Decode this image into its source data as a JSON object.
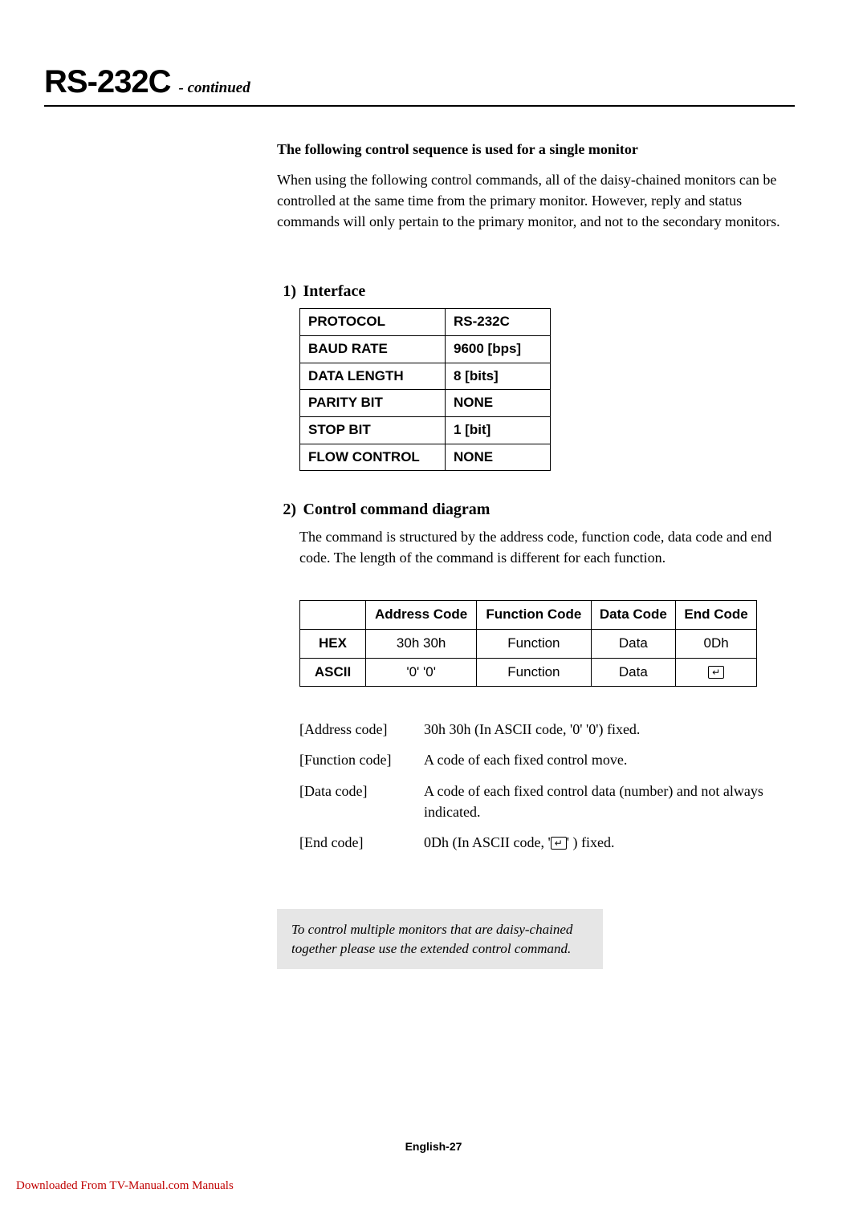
{
  "header": {
    "title": "RS-232C",
    "sub": "- continued"
  },
  "intro": {
    "heading": "The following control sequence is used for a single monitor",
    "body": "When using the following control commands, all of the daisy-chained monitors can be controlled at the same time from the primary monitor. However, reply and status commands will only pertain to the primary monitor, and not to the secondary monitors."
  },
  "section1": {
    "num": "1)",
    "title": "Interface",
    "rows": [
      {
        "k": "PROTOCOL",
        "v": "RS-232C"
      },
      {
        "k": "BAUD RATE",
        "v": "9600 [bps]"
      },
      {
        "k": "DATA LENGTH",
        "v": "8 [bits]"
      },
      {
        "k": "PARITY BIT",
        "v": "NONE"
      },
      {
        "k": "STOP BIT",
        "v": "1 [bit]"
      },
      {
        "k": "FLOW CONTROL",
        "v": "NONE"
      }
    ]
  },
  "section2": {
    "num": "2)",
    "title": "Control command diagram",
    "body": "The command is structured by the address code, function code, data code and end code. The length of the command is different for each function.",
    "table": {
      "headers": [
        "",
        "Address Code",
        "Function Code",
        "Data Code",
        "End Code"
      ],
      "rows": [
        {
          "label": "HEX",
          "cells": [
            "30h 30h",
            "Function",
            "Data",
            "0Dh"
          ]
        },
        {
          "label": "ASCII",
          "cells": [
            "'0' '0'",
            "Function",
            "Data",
            "↵"
          ]
        }
      ]
    },
    "defs": [
      {
        "label": "[Address code]",
        "value": "30h 30h (In ASCII code, '0' '0') fixed."
      },
      {
        "label": "[Function code]",
        "value": "A code of each fixed control move."
      },
      {
        "label": "[Data code]",
        "value": "A code of each fixed control data (number) and not always indicated."
      },
      {
        "label": "[End code]",
        "value": "0Dh (In ASCII code, ' ↵ ' ) fixed."
      }
    ]
  },
  "note": "To control multiple monitors that are daisy-chained together please use the extended control command.",
  "footer": "English-27",
  "download": "Downloaded From TV-Manual.com Manuals"
}
